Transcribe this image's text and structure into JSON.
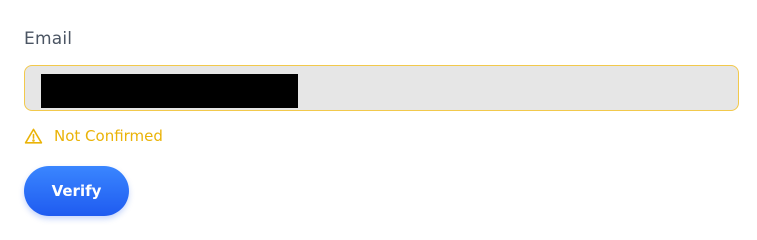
{
  "email_field": {
    "label": "Email",
    "value_redacted": true
  },
  "status": {
    "icon": "warning-icon",
    "text": "Not Confirmed",
    "color": "#eab308"
  },
  "verify_button": {
    "label": "Verify",
    "color": "#2563eb"
  }
}
